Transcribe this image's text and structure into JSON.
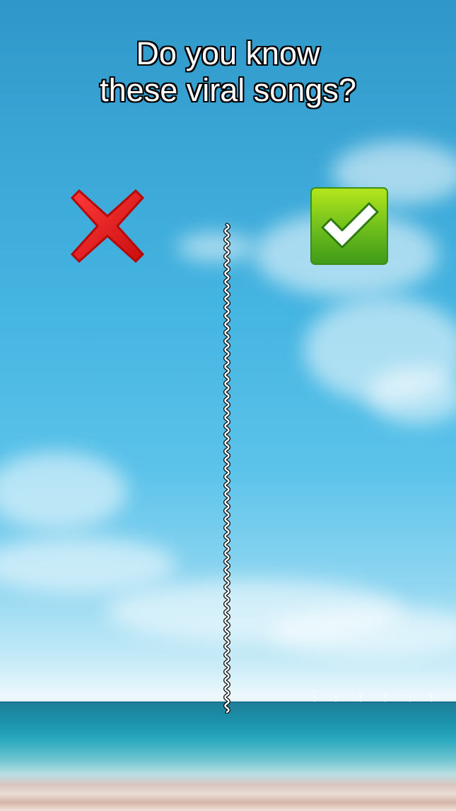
{
  "overlay": {
    "title_line1": "Do you know",
    "title_line2": "these viral songs?"
  },
  "icons": {
    "left": "red-cross-mark-icon",
    "right": "green-check-mark-icon",
    "divider": "wavy-divider-line"
  },
  "colors": {
    "sky_top": "#2f97c9",
    "sky_mid": "#46b6e2",
    "sea": "#1a93ab",
    "cross_red": "#e01616",
    "check_green": "#6cbd1c",
    "text": "#ffffff",
    "text_outline": "#000000"
  }
}
